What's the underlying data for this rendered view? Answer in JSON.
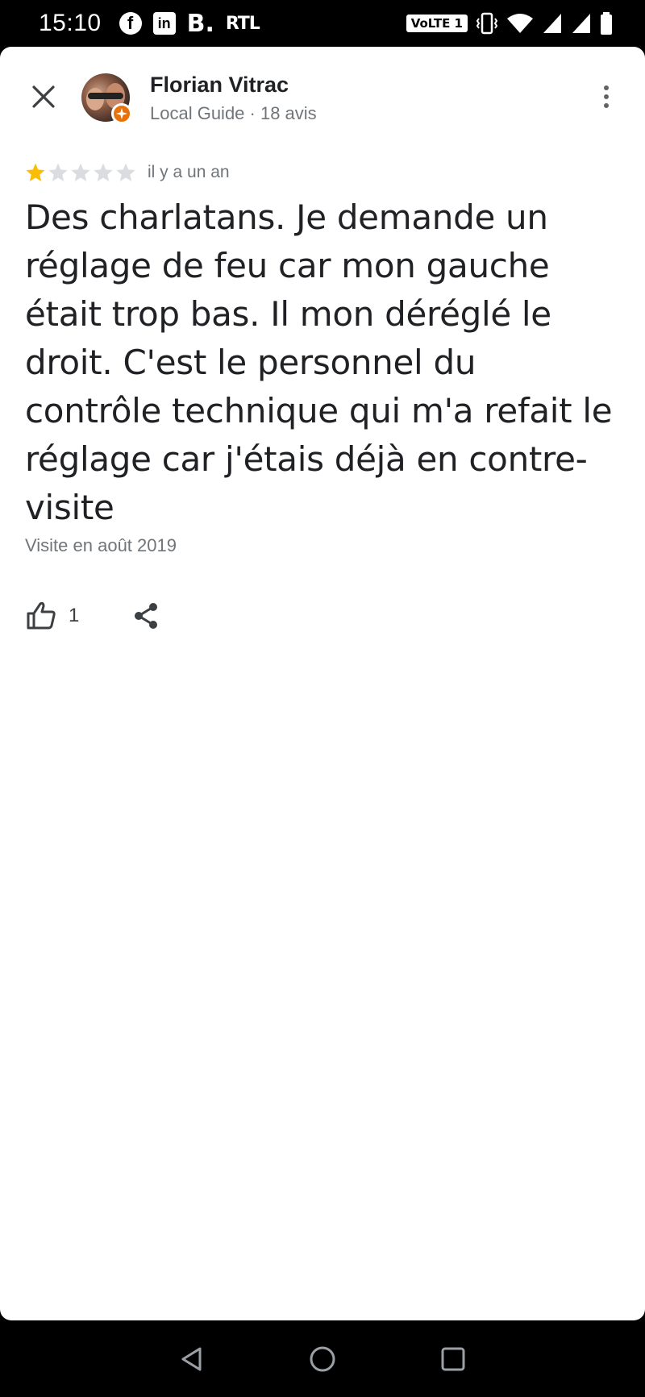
{
  "status_bar": {
    "time": "15:10",
    "app_icons": [
      "facebook-icon",
      "linkedin-icon",
      "b-news-icon",
      "rtl-icon"
    ],
    "b_label": "B.",
    "rtl_label": "RTL",
    "volte_label": "VoLTE 1"
  },
  "review": {
    "author": "Florian Vitrac",
    "author_meta": "Local Guide · 18 avis",
    "rating": 1,
    "rating_max": 5,
    "time": "il y a un an",
    "text": "Des charlatans. Je demande un réglage de feu car mon gauche était trop bas. Il mon déréglé le droit. C'est le personnel du contrôle technique qui m'a refait le réglage car j'étais déjà en contre-visite",
    "visit": "Visite en août 2019",
    "likes": "1"
  },
  "colors": {
    "star_filled": "#fbbc04",
    "star_empty": "#dadce0",
    "guide_badge": "#e8710a",
    "text_primary": "#202124",
    "text_secondary": "#70757a"
  }
}
